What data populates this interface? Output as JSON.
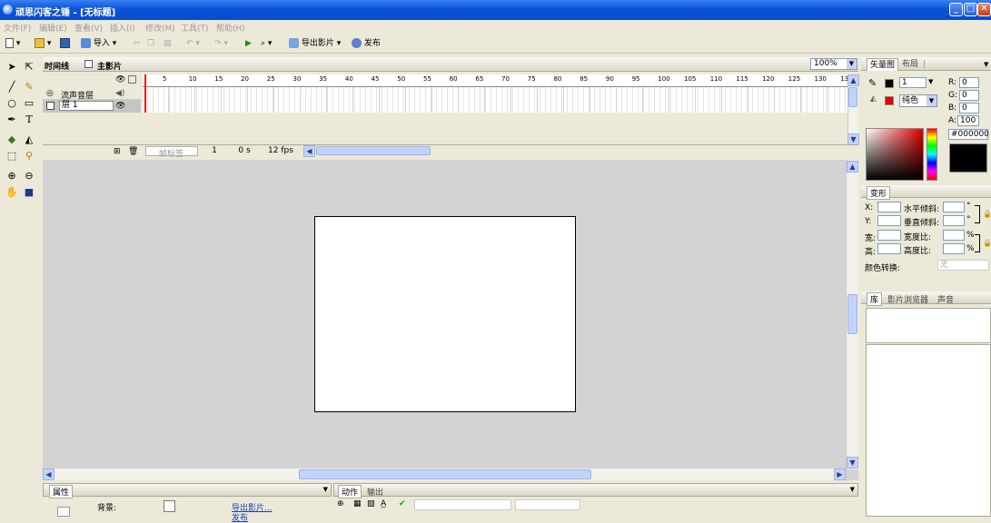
{
  "window": {
    "title": "顽思闪客之锤 - [无标题]",
    "min": "_",
    "max": "□",
    "close": "✕"
  },
  "menu": [
    "文件(F)",
    "编辑(E)",
    "查看(V)",
    "插入(I)",
    "修改(M)",
    "工具(T)",
    "帮助(H)"
  ],
  "toolbar": {
    "import": "导入",
    "export_movie": "导出影片",
    "publish": "发布"
  },
  "timeline": {
    "tab_label": "时间线",
    "scene_label": "主影片",
    "zoom": "100%",
    "layers": [
      {
        "name": "流声音层"
      },
      {
        "name": "层 1"
      }
    ],
    "ruler_ticks": [
      "5",
      "10",
      "15",
      "20",
      "25",
      "30",
      "35",
      "40",
      "45",
      "50",
      "55",
      "60",
      "65",
      "70",
      "75",
      "80",
      "85",
      "90",
      "95",
      "100",
      "105",
      "110",
      "115",
      "120",
      "125",
      "130",
      "13"
    ],
    "status": {
      "frame_label": "帧标签",
      "frame": "1",
      "time": "0 s",
      "fps": "12 fps"
    }
  },
  "right_panel": {
    "tabs": [
      "矢量图",
      "布局"
    ],
    "stroke_width": "1",
    "fill_type": "纯色",
    "r": "0",
    "g": "0",
    "b": "0",
    "a": "100",
    "hex": "#000000",
    "r_label": "R:",
    "g_label": "G:",
    "b_label": "B:",
    "a_label": "A:",
    "transform": {
      "title": "变形",
      "x": "X:",
      "y": "Y:",
      "w": "宽:",
      "h": "高:",
      "hskew": "水平倾斜:",
      "vskew": "垂直倾斜:",
      "wratio": "宽度比:",
      "hratio": "高度比:",
      "deg": "°",
      "pct": "%",
      "color_transform": "颜色转换:",
      "none": "无"
    },
    "library_tabs": [
      "库",
      "影片浏览器",
      "声音"
    ]
  },
  "properties": {
    "tab": "属性",
    "bg_label": "背景:",
    "export_link": "导出影片...",
    "publish_link": "发布"
  },
  "actions": {
    "tabs": [
      "动作",
      "输出"
    ]
  }
}
